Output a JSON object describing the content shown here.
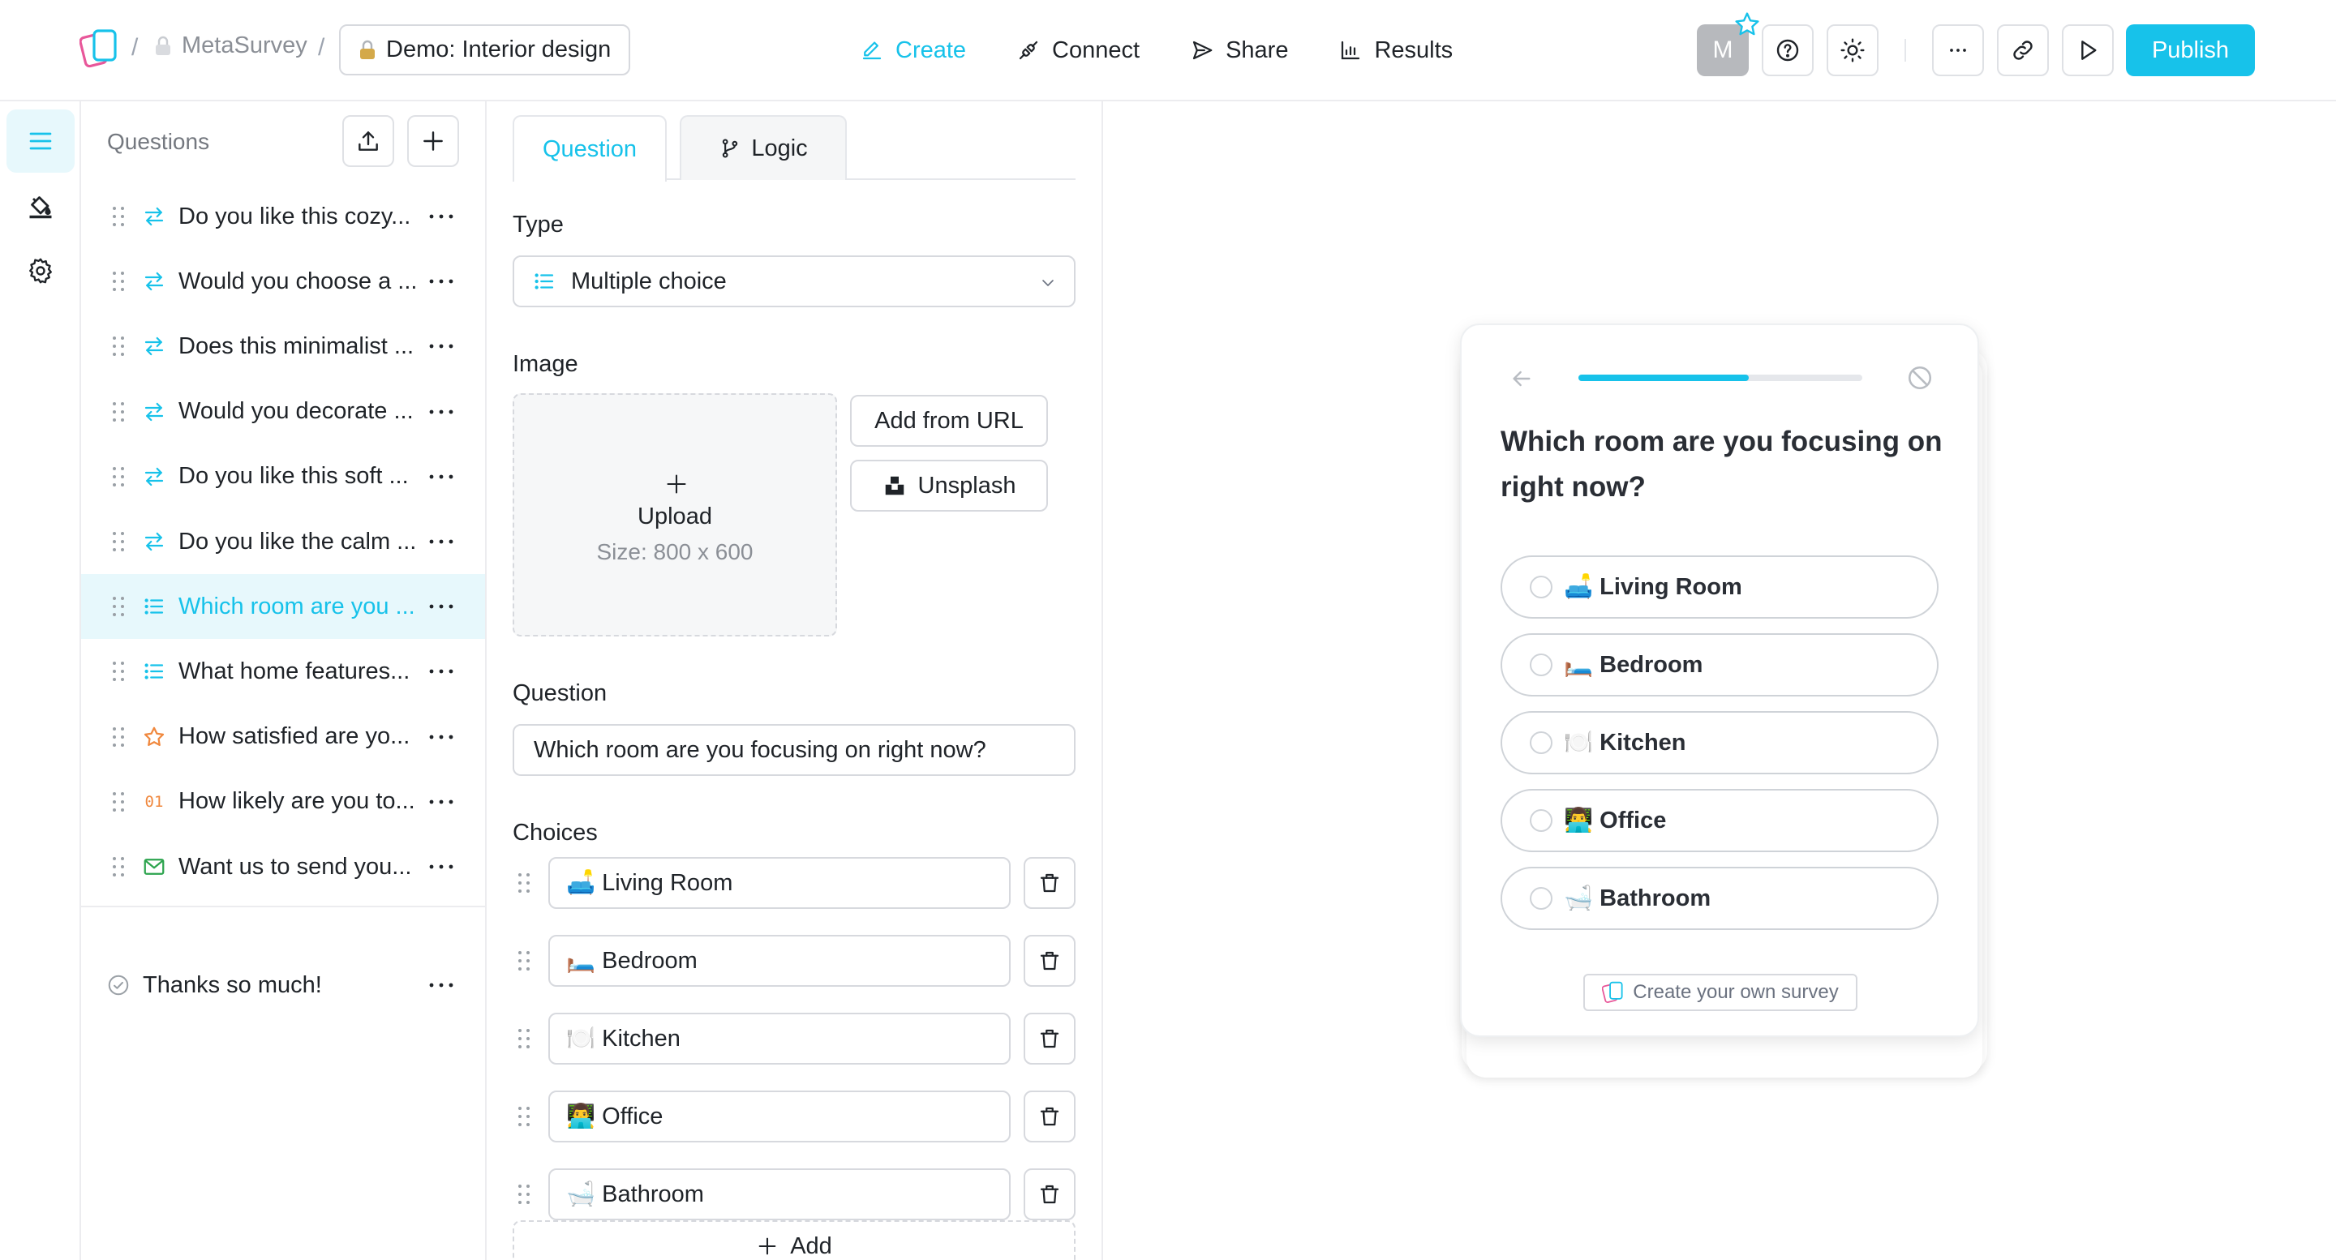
{
  "header": {
    "org_name": "MetaSurvey",
    "project_name": "Demo: Interior design",
    "separator": "/",
    "nav": [
      {
        "label": "Create",
        "icon": "pencil-icon",
        "active": true
      },
      {
        "label": "Connect",
        "icon": "plug-icon",
        "active": false
      },
      {
        "label": "Share",
        "icon": "send-icon",
        "active": false
      },
      {
        "label": "Results",
        "icon": "bar-chart-icon",
        "active": false
      }
    ],
    "avatar_initial": "M",
    "publish_label": "Publish"
  },
  "questions_panel": {
    "title": "Questions",
    "items": [
      {
        "label": "Do you like this cozy...",
        "type": "yes-no",
        "active": false
      },
      {
        "label": "Would you choose a ...",
        "type": "yes-no",
        "active": false
      },
      {
        "label": "Does this minimalist ...",
        "type": "yes-no",
        "active": false
      },
      {
        "label": "Would you decorate ...",
        "type": "yes-no",
        "active": false
      },
      {
        "label": "Do you like this soft ...",
        "type": "yes-no",
        "active": false
      },
      {
        "label": "Do you like the calm ...",
        "type": "yes-no",
        "active": false
      },
      {
        "label": "Which room are you ...",
        "type": "multiple-choice",
        "active": true
      },
      {
        "label": "What home features...",
        "type": "multiple-choice",
        "active": false
      },
      {
        "label": "How satisfied are yo...",
        "type": "rating",
        "active": false
      },
      {
        "label": "How likely are you to...",
        "type": "nps",
        "type_badge": "01",
        "active": false
      },
      {
        "label": "Want us to send you...",
        "type": "email",
        "active": false
      }
    ],
    "ending": {
      "label": "Thanks so much!"
    }
  },
  "editor": {
    "tabs": [
      {
        "label": "Question",
        "active": true
      },
      {
        "label": "Logic",
        "active": false
      }
    ],
    "type_label": "Type",
    "type_value": "Multiple choice",
    "image_label": "Image",
    "upload_title": "Upload",
    "upload_size": "Size: 800 x 600",
    "add_from_url": "Add from URL",
    "unsplash": "Unsplash",
    "question_label": "Question",
    "question_value": "Which room are you focusing on right now?",
    "choices_label": "Choices",
    "choices": [
      {
        "label": "🛋️ Living Room"
      },
      {
        "label": "🛏️ Bedroom"
      },
      {
        "label": "🍽️ Kitchen"
      },
      {
        "label": "👨‍💻 Office"
      },
      {
        "label": "🛁 Bathroom"
      }
    ],
    "add_label": "Add"
  },
  "preview": {
    "progress": 0.6,
    "question": "Which room are you focusing on right now?",
    "options": [
      {
        "label": "🛋️ Living Room"
      },
      {
        "label": "🛏️ Bedroom"
      },
      {
        "label": "🍽️ Kitchen"
      },
      {
        "label": "👨‍💻 Office"
      },
      {
        "label": "🛁 Bathroom"
      }
    ],
    "footer_link": "Create your own survey"
  },
  "colors": {
    "accent": "#17c2ea",
    "rating_star": "#f0883e",
    "email_icon": "#2da44e",
    "text": "#1f2328",
    "muted": "#8b8f96",
    "border": "#d7d9de"
  }
}
